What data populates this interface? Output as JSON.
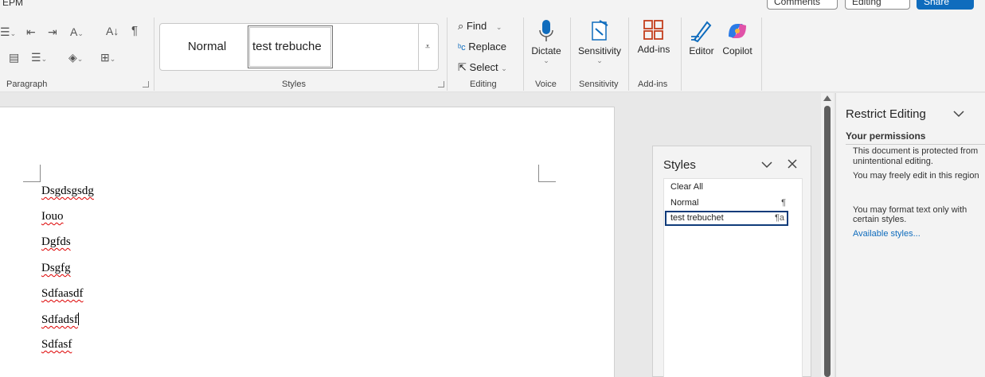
{
  "topbar": {
    "app_fragment": "EPM",
    "comments_label": "Comments",
    "editing_label": "Editing",
    "share_label": "Share"
  },
  "ribbon": {
    "paragraph_group_label": "Paragraph",
    "styles_group_label": "Styles",
    "editing_group_label": "Editing",
    "voice_group_label": "Voice",
    "sensitivity_group_label": "Sensitivity",
    "addins_group_label": "Add-ins",
    "styles_gallery": {
      "normal_label": "Normal",
      "custom_label": "test trebuche"
    },
    "editing": {
      "find_label": "Find",
      "replace_label": "Replace",
      "select_label": "Select"
    },
    "dictate_label": "Dictate",
    "sensitivity_label": "Sensitivity",
    "addins_label": "Add-ins",
    "editor_label": "Editor",
    "copilot_label": "Copilot"
  },
  "document": {
    "paragraphs": [
      "Dsgdsgsdg",
      "Iouo",
      "Dgfds",
      "Dsgfg",
      "Sdfaasdf",
      "Sdfadsf",
      "Sdfasf"
    ]
  },
  "styles_pane": {
    "title": "Styles",
    "items": [
      {
        "label": "Clear All",
        "mark": ""
      },
      {
        "label": "Normal",
        "mark": "¶"
      },
      {
        "label": "test trebuchet",
        "mark": "¶a"
      }
    ]
  },
  "restrict_pane": {
    "title": "Restrict Editing",
    "permissions_heading": "Your permissions",
    "line1": "This document is protected from",
    "line2": "unintentional editing.",
    "line3": "You may freely edit in this region",
    "line4": "You may format text only with",
    "line5": "certain styles.",
    "link": "Available styles..."
  },
  "colors": {
    "accent": "#0f6cbd",
    "ribbon_bg": "#f3f3f3",
    "canvas_bg": "#e8e8e8"
  }
}
